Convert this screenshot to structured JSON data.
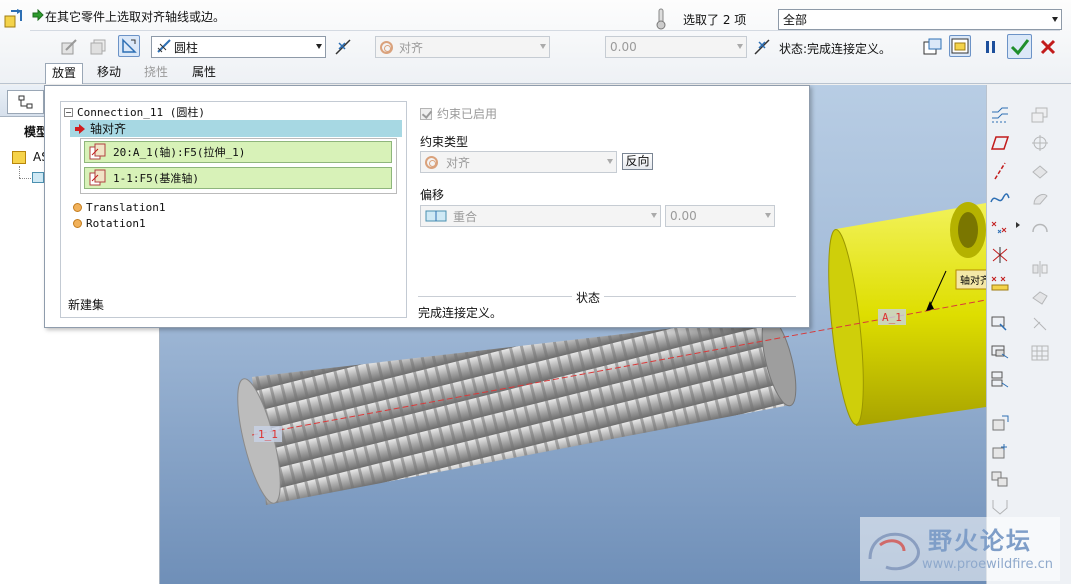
{
  "dashboard": {
    "prompt": "在其它零件上选取对齐轴线或边。",
    "selected_count": "选取了 2 项",
    "filter_value": "全部",
    "connection_type": "圆柱",
    "constraint_type_top": "对齐",
    "offset_top": "0.00",
    "status": "状态:完成连接定义。",
    "tabs": [
      "放置",
      "移动",
      "挠性",
      "属性"
    ]
  },
  "model_tree": {
    "title": "模型",
    "root_label": "AS"
  },
  "placement": {
    "connection_title": "Connection_11 (圆柱)",
    "axis_align": "轴对齐",
    "refs": [
      "20:A_1(轴):F5(拉伸_1)",
      "1-1:F5(基准轴)"
    ],
    "translation": "Translation1",
    "rotation": "Rotation1",
    "new_set": "新建集",
    "constraint_enabled": "约束已启用",
    "constraint_type_label": "约束类型",
    "constraint_type_value": "对齐",
    "flip": "反向",
    "offset_label": "偏移",
    "offset_mode": "重合",
    "offset_value": "0.00",
    "status_label": "状态",
    "status_text": "完成连接定义。"
  },
  "viewport": {
    "axis_label_right": "A_1",
    "axis_label_left": "1_1",
    "callout": "轴对齐"
  },
  "watermark": {
    "brand": "野火论坛",
    "url": "www.proewildfire.cn"
  },
  "colors": {
    "cyl_yellow": "#dede00",
    "axis_red": "#d93a3a",
    "highlight_row": "#a7d8e3",
    "ref_green": "#d8f2b8"
  }
}
